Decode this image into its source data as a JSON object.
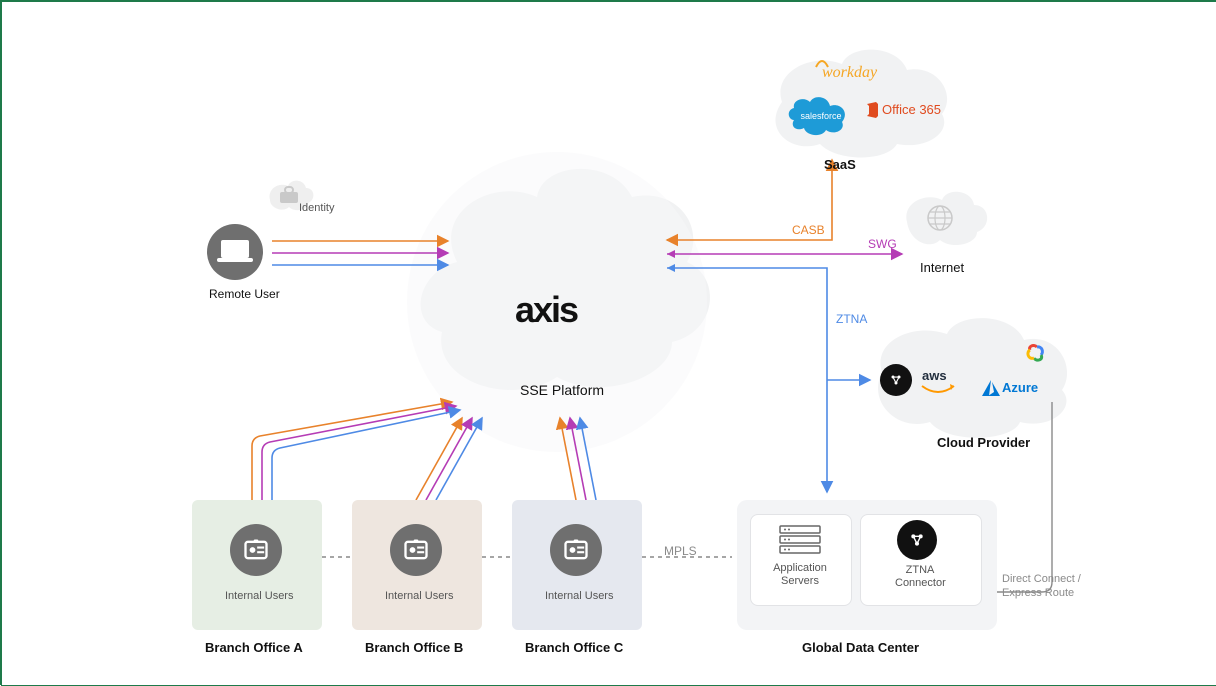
{
  "center": {
    "brand": "axis",
    "subtitle": "SSE Platform"
  },
  "left": {
    "remote_user": "Remote User",
    "identity": "Identity"
  },
  "branches": {
    "a": {
      "title": "Branch Office A",
      "user_label": "Internal Users"
    },
    "b": {
      "title": "Branch Office B",
      "user_label": "Internal Users"
    },
    "c": {
      "title": "Branch Office C",
      "user_label": "Internal Users"
    }
  },
  "right": {
    "saas_label": "SaaS",
    "internet_label": "Internet",
    "cloud_provider_label": "Cloud Provider",
    "gdc_label": "Global Data Center",
    "app_servers": "Application\nServers",
    "ztna_connector": "ZTNA\nConnector",
    "direct_connect": "Direct Connect /\nExpress Route"
  },
  "edge_labels": {
    "casb": "CASB",
    "swg": "SWG",
    "ztna": "ZTNA",
    "mpls": "MPLS"
  },
  "saas_logos": {
    "workday": "workday",
    "salesforce": "salesforce",
    "office365": "Office 365"
  },
  "cloud_logos": {
    "aws": "aws",
    "azure": "Azure"
  },
  "colors": {
    "orange": "#e8822b",
    "pink": "#b53cb5",
    "blue": "#4e8ae5",
    "gray": "#8a8a8a"
  }
}
